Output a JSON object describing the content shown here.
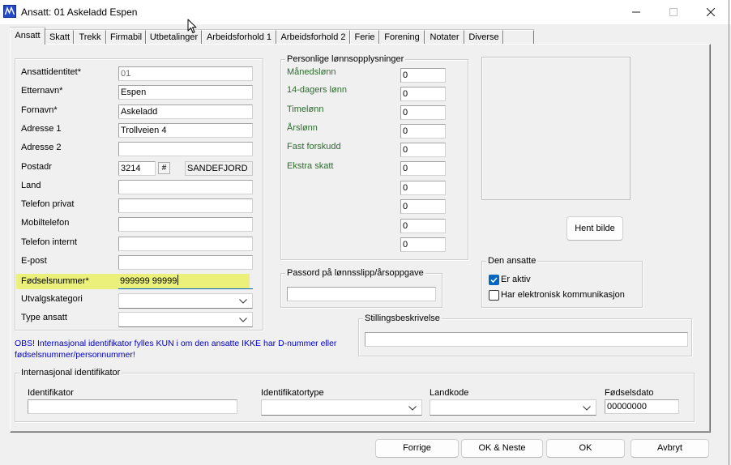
{
  "window": {
    "title": "Ansatt: 01 Askeladd Espen",
    "icon": "app-waveform-icon",
    "controls": {
      "minimize": "minimize-icon",
      "maximize": "maximize-icon",
      "close": "close-icon"
    }
  },
  "tabs": [
    "Ansatt",
    "Skatt",
    "Trekk",
    "Firmabil",
    "Utbetalinger",
    "Arbeidsforhold 1",
    "Arbeidsforhold 2",
    "Ferie",
    "Forening",
    "Notater",
    "Diverse"
  ],
  "active_tab_index": 0,
  "employee": {
    "id": {
      "label": "Ansattidentitet*",
      "value": "01"
    },
    "last_name": {
      "label": "Etternavn*",
      "value": "Espen"
    },
    "first_name": {
      "label": "Fornavn*",
      "value": "Askeladd"
    },
    "address1": {
      "label": "Adresse 1",
      "value": "Trollveien 4"
    },
    "address2": {
      "label": "Adresse 2",
      "value": ""
    },
    "postal": {
      "label": "Postadr",
      "code": "3214",
      "lookup_button": "#",
      "city": "SANDEFJORD"
    },
    "country": {
      "label": "Land",
      "value": ""
    },
    "phone_private": {
      "label": "Telefon privat",
      "value": ""
    },
    "mobile": {
      "label": "Mobiltelefon",
      "value": ""
    },
    "phone_internal": {
      "label": "Telefon internt",
      "value": ""
    },
    "email": {
      "label": "E-post",
      "value": ""
    },
    "ssn": {
      "label": "Fødselsnummer*",
      "value": "999999 99999"
    },
    "selection_category": {
      "label": "Utvalgskategori",
      "selected": ""
    },
    "employee_type": {
      "label": "Type ansatt",
      "selected": ""
    }
  },
  "salary": {
    "title": "Personlige lønnsopplysninger",
    "rows": [
      {
        "label": "Månedslønn",
        "value": "0"
      },
      {
        "label": "14-dagers lønn",
        "value": "0"
      },
      {
        "label": "Timelønn",
        "value": "0"
      },
      {
        "label": "Årslønn",
        "value": "0"
      },
      {
        "label": "Fast forskudd",
        "value": "0"
      },
      {
        "label": "Ekstra skatt",
        "value": "0"
      },
      {
        "value": "0"
      },
      {
        "value": "0"
      },
      {
        "value": "0"
      },
      {
        "value": "0"
      }
    ]
  },
  "photo": {
    "button": "Hent bilde"
  },
  "password": {
    "title": "Passord på lønnsslipp/årsoppgave",
    "value": ""
  },
  "status": {
    "title": "Den ansatte",
    "active": {
      "label": "Er aktiv",
      "checked": true
    },
    "electronic": {
      "label": "Har elektronisk kommunikasjon",
      "checked": false
    }
  },
  "job_description": {
    "title": "Stillingsbeskrivelse",
    "value": ""
  },
  "notice": [
    "OBS! Internasjonal identifikator fylles KUN i om den ansatte IKKE har D-nummer eller",
    "fødselsnummer/personnummer!"
  ],
  "international_id": {
    "title": "Internasjonal identifikator",
    "identifier": {
      "label": "Identifikator",
      "value": ""
    },
    "identifier_type": {
      "label": "Identifikatortype",
      "selected": ""
    },
    "country_code": {
      "label": "Landkode",
      "selected": ""
    },
    "birth_date": {
      "label": "Fødselsdato",
      "value": "00000000"
    }
  },
  "buttons": {
    "previous": "Forrige",
    "ok_next": "OK & Neste",
    "ok": "OK",
    "cancel": "Avbryt"
  },
  "colors": {
    "highlight": "#eaf07a",
    "notice_text": "#0000c8",
    "salary_label": "#2e6b30",
    "focus": "#0067c0",
    "checkbox": "#0067c0"
  }
}
